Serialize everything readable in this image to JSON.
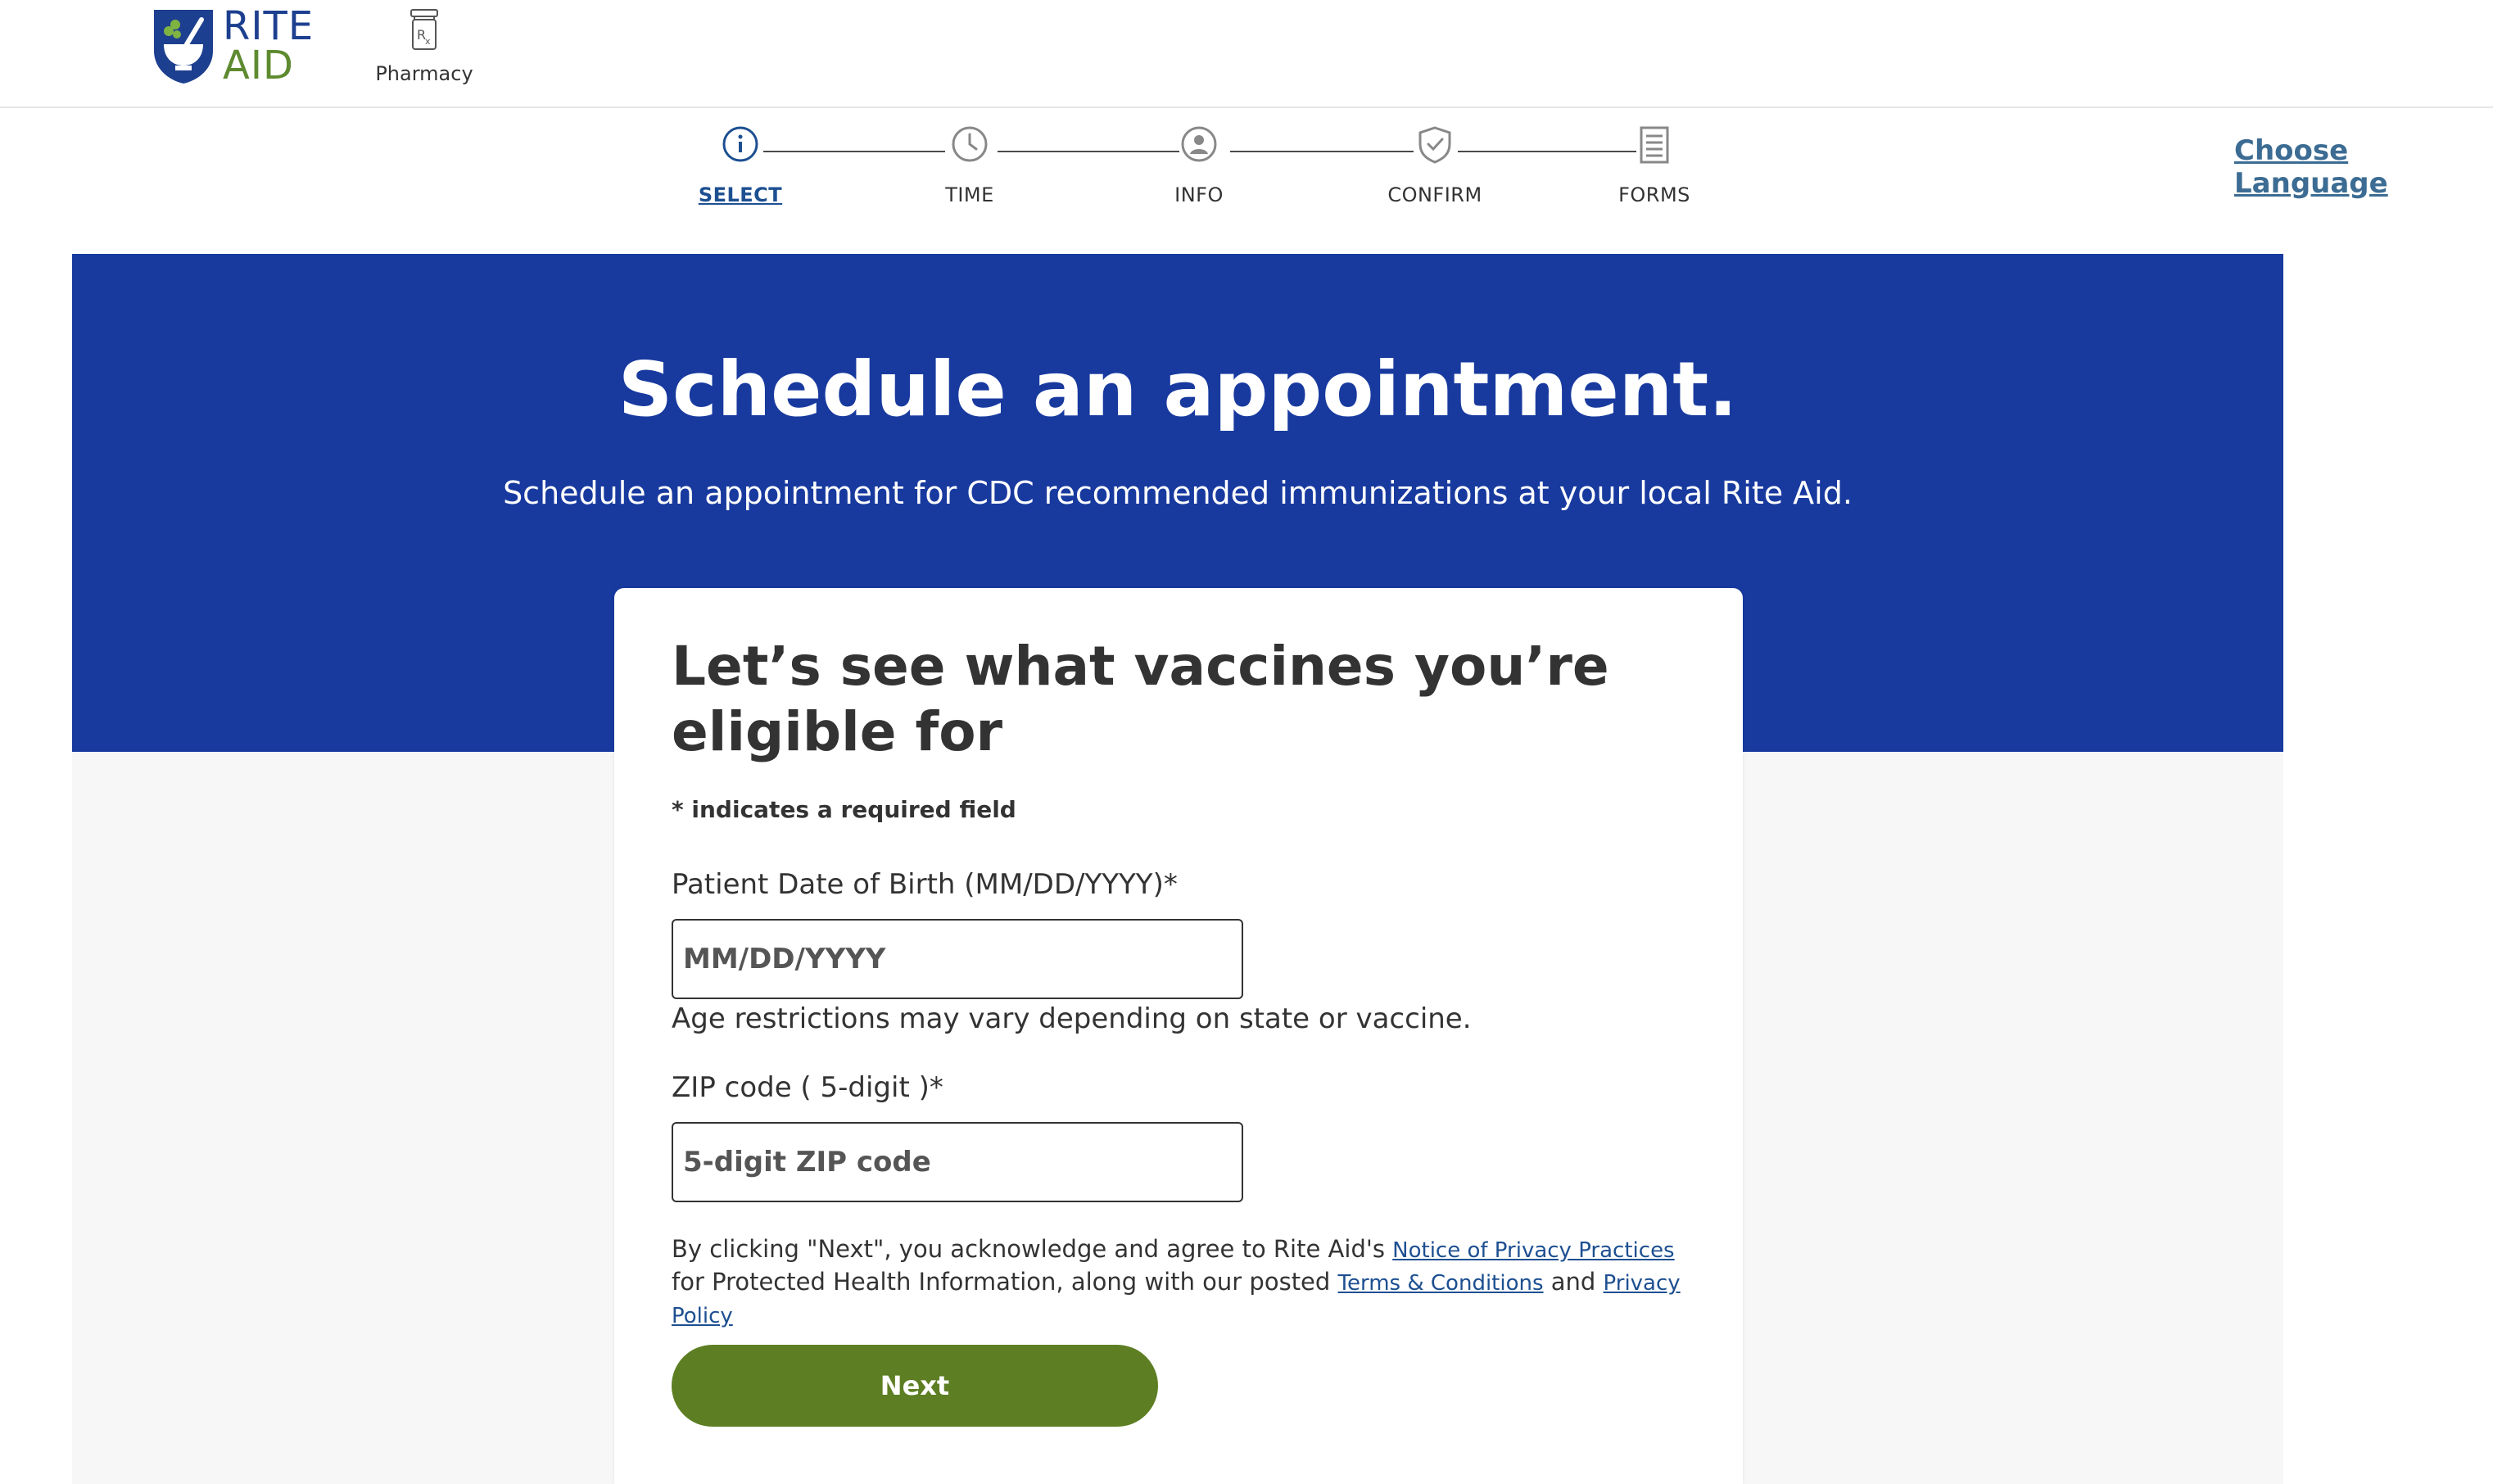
{
  "header": {
    "logo_line1": "RITE",
    "logo_line2": "AID",
    "pharmacy_label": "Pharmacy",
    "choose_language": "Choose Language"
  },
  "stepper": {
    "steps": [
      {
        "label": "SELECT",
        "icon": "info-icon",
        "active": true
      },
      {
        "label": "TIME",
        "icon": "clock-icon",
        "active": false
      },
      {
        "label": "INFO",
        "icon": "user-icon",
        "active": false
      },
      {
        "label": "CONFIRM",
        "icon": "shield-check-icon",
        "active": false
      },
      {
        "label": "FORMS",
        "icon": "document-icon",
        "active": false
      }
    ]
  },
  "hero": {
    "title": "Schedule an appointment.",
    "subtitle": "Schedule an appointment for CDC recommended immunizations at your local Rite Aid."
  },
  "form": {
    "title": "Let’s see what vaccines you’re eligible for",
    "required_note": "* indicates a required field",
    "dob": {
      "label": "Patient Date of Birth (MM/DD/YYYY)*",
      "placeholder": "MM/DD/YYYY",
      "helper": "Age restrictions may vary depending on state or vaccine."
    },
    "zip": {
      "label": "ZIP code ( 5-digit )*",
      "placeholder": "5-digit ZIP code"
    },
    "consent": {
      "part1": "By clicking \"Next\", you acknowledge and agree to Rite Aid's ",
      "link1": "Notice of Privacy Practices",
      "part2": " for Protected Health Information, along with our posted ",
      "link2": "Terms & Conditions",
      "part3": " and ",
      "link3": "Privacy Policy"
    },
    "next_label": "Next"
  },
  "colors": {
    "hero_blue": "#183a9f",
    "button_green": "#5d7e22",
    "link_blue": "#1d4f91"
  }
}
